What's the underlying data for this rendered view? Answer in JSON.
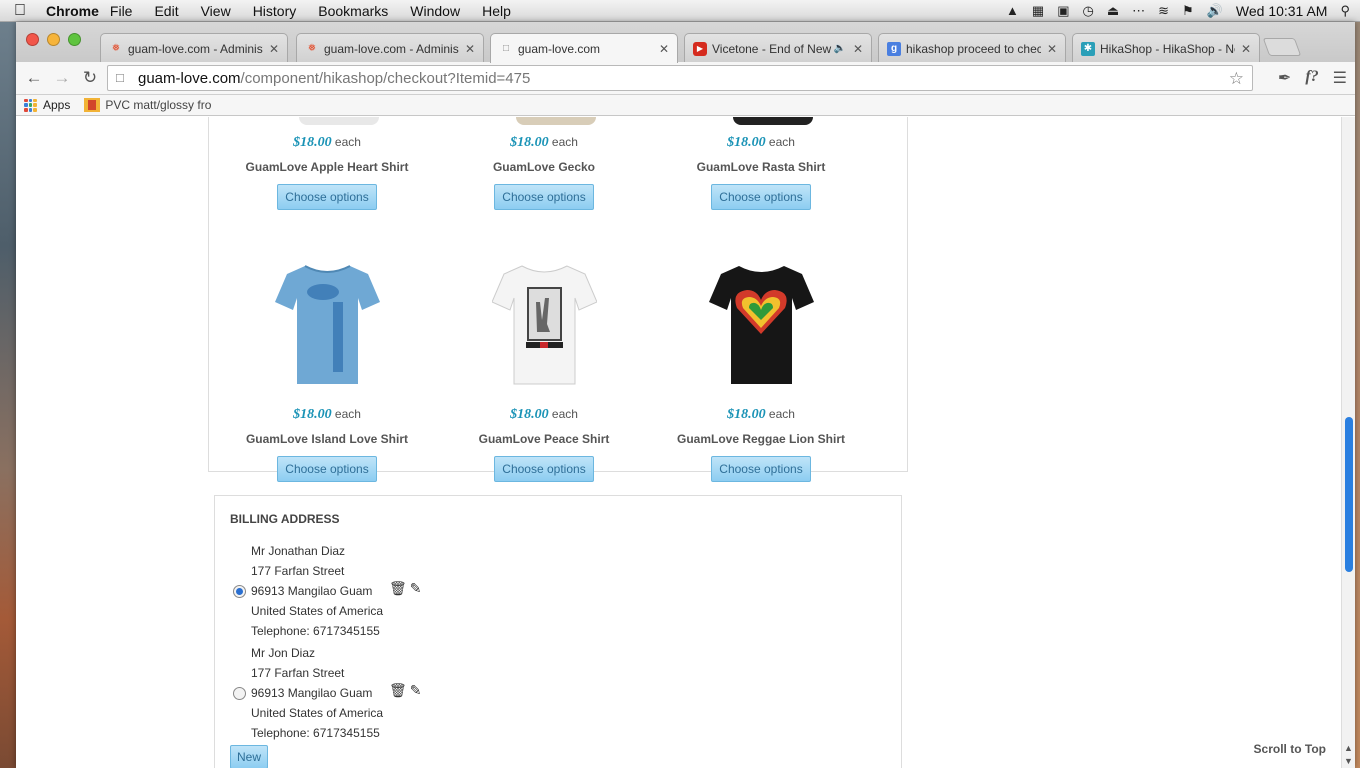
{
  "menubar": {
    "app_name": "Chrome",
    "items": [
      "File",
      "Edit",
      "View",
      "History",
      "Bookmarks",
      "Window",
      "Help"
    ],
    "clock": "Wed 10:31 AM"
  },
  "tabs": [
    {
      "title": "guam-love.com - Administ",
      "icon": "joomla-icon",
      "active": false
    },
    {
      "title": "guam-love.com - Administ",
      "icon": "joomla-icon",
      "active": false
    },
    {
      "title": "guam-love.com",
      "icon": "page-icon",
      "active": true
    },
    {
      "title": "Vicetone - End of New Y",
      "icon": "youtube-icon",
      "active": false
    },
    {
      "title": "hikashop proceed to check",
      "icon": "google-icon",
      "active": false
    },
    {
      "title": "HikaShop - HikaShop - Ne",
      "icon": "hikashop-icon",
      "active": false
    }
  ],
  "address_bar": {
    "host": "guam-love.com",
    "path": "/component/hikashop/checkout?Itemid=475"
  },
  "bookmarks": [
    {
      "label": "Apps"
    },
    {
      "label": "PVC matt/glossy fro"
    }
  ],
  "products": [
    {
      "price": "$18.00",
      "each": "each",
      "name": "GuamLove Apple Heart Shirt",
      "button": "Choose options"
    },
    {
      "price": "$18.00",
      "each": "each",
      "name": "GuamLove Gecko",
      "button": "Choose options"
    },
    {
      "price": "$18.00",
      "each": "each",
      "name": "GuamLove Rasta Shirt",
      "button": "Choose options"
    },
    {
      "price": "$18.00",
      "each": "each",
      "name": "GuamLove Island Love Shirt",
      "button": "Choose options",
      "shirt_color": "#6fa8d4"
    },
    {
      "price": "$18.00",
      "each": "each",
      "name": "GuamLove Peace Shirt",
      "button": "Choose options",
      "shirt_color": "#f4f4f4"
    },
    {
      "price": "$18.00",
      "each": "each",
      "name": "GuamLove Reggae Lion Shirt",
      "button": "Choose options",
      "shirt_color": "#161616"
    }
  ],
  "billing": {
    "title": "BILLING ADDRESS",
    "addresses": [
      {
        "selected": true,
        "lines": [
          "Mr Jonathan Diaz",
          "177 Farfan Street",
          "96913 Mangilao Guam",
          "United States of America",
          "Telephone: 6717345155"
        ]
      },
      {
        "selected": false,
        "lines": [
          "Mr Jon Diaz",
          "177 Farfan Street",
          "96913 Mangilao Guam",
          "United States of America",
          "Telephone: 6717345155"
        ]
      }
    ],
    "new_button": "New"
  },
  "scroll_to_top": "Scroll to Top"
}
